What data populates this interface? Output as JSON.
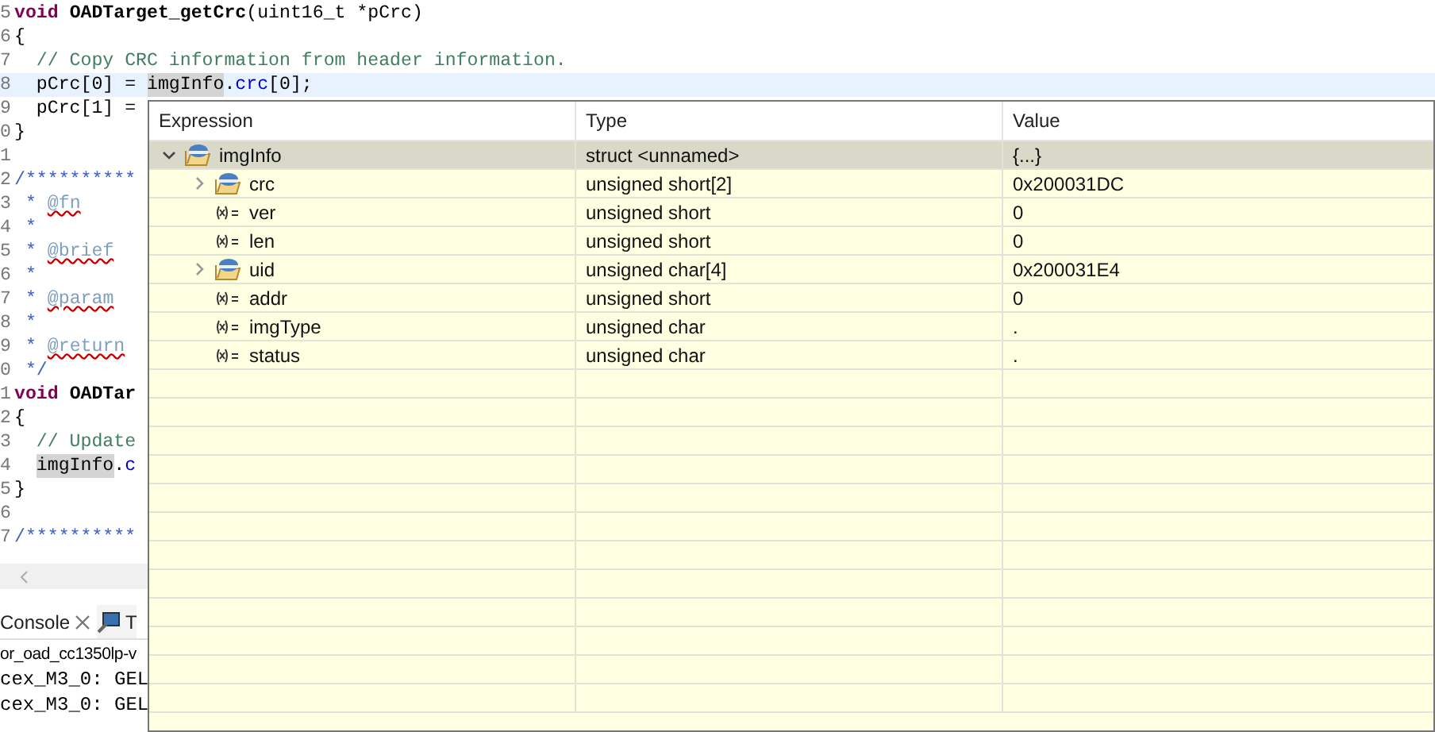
{
  "editor": {
    "lines": [
      {
        "number": "5",
        "current": false,
        "segments": [
          {
            "kind": "keyword",
            "text": "void"
          },
          {
            "kind": "bold",
            "text": " OADTarget_getCrc"
          },
          {
            "kind": "plain",
            "text": "(uint16_t *pCrc)"
          }
        ]
      },
      {
        "number": "6",
        "current": false,
        "segments": [
          {
            "kind": "plain",
            "text": "{"
          }
        ]
      },
      {
        "number": "7",
        "current": false,
        "segments": [
          {
            "kind": "comment",
            "text": "  // Copy CRC information from header information."
          }
        ]
      },
      {
        "number": "8",
        "current": true,
        "segments": [
          {
            "kind": "plain",
            "text": "  pCrc[0] = "
          },
          {
            "kind": "occurrence",
            "text": "imgInfo"
          },
          {
            "kind": "plain",
            "text": "."
          },
          {
            "kind": "field",
            "text": "crc"
          },
          {
            "kind": "plain",
            "text": "[0];"
          }
        ]
      },
      {
        "number": "9",
        "current": false,
        "segments": [
          {
            "kind": "plain",
            "text": "  pCrc[1] ="
          }
        ]
      },
      {
        "number": "0",
        "current": false,
        "segments": [
          {
            "kind": "plain",
            "text": "}"
          }
        ]
      },
      {
        "number": "1",
        "current": false
      },
      {
        "number": "2",
        "current": false,
        "segments": [
          {
            "kind": "doc",
            "text": "/**********"
          }
        ]
      },
      {
        "number": "3",
        "current": false,
        "segments": [
          {
            "kind": "doc",
            "text": " *"
          },
          {
            "kind": "tag",
            "text": " @fn"
          }
        ]
      },
      {
        "number": "4",
        "current": false,
        "segments": [
          {
            "kind": "doc",
            "text": " *"
          }
        ]
      },
      {
        "number": "5",
        "current": false,
        "segments": [
          {
            "kind": "doc",
            "text": " *"
          },
          {
            "kind": "tag",
            "text": " @brief"
          }
        ]
      },
      {
        "number": "6",
        "current": false,
        "segments": [
          {
            "kind": "doc",
            "text": " *"
          }
        ]
      },
      {
        "number": "7",
        "current": false,
        "segments": [
          {
            "kind": "doc",
            "text": " *"
          },
          {
            "kind": "tag",
            "text": " @param"
          }
        ]
      },
      {
        "number": "8",
        "current": false,
        "segments": [
          {
            "kind": "doc",
            "text": " *"
          }
        ]
      },
      {
        "number": "9",
        "current": false,
        "segments": [
          {
            "kind": "doc",
            "text": " *"
          },
          {
            "kind": "tag",
            "text": " @return"
          }
        ]
      },
      {
        "number": "0",
        "current": false,
        "segments": [
          {
            "kind": "doc",
            "text": " */"
          }
        ]
      },
      {
        "number": "1",
        "current": false,
        "segments": [
          {
            "kind": "keyword",
            "text": "void"
          },
          {
            "kind": "bold",
            "text": " OADTar"
          }
        ]
      },
      {
        "number": "2",
        "current": false,
        "segments": [
          {
            "kind": "plain",
            "text": "{"
          }
        ]
      },
      {
        "number": "3",
        "current": false,
        "segments": [
          {
            "kind": "comment",
            "text": "  // Update"
          }
        ]
      },
      {
        "number": "4",
        "current": false,
        "segments": [
          {
            "kind": "occurrence",
            "text": "  imgInfo"
          },
          {
            "kind": "plain",
            "text": "."
          },
          {
            "kind": "field",
            "text": "c"
          }
        ]
      },
      {
        "number": "5",
        "current": false,
        "segments": [
          {
            "kind": "plain",
            "text": "}"
          }
        ]
      },
      {
        "number": "6",
        "current": false
      },
      {
        "number": "7",
        "current": false,
        "segments": [
          {
            "kind": "doc",
            "text": "/**********"
          }
        ]
      }
    ]
  },
  "console": {
    "tabs": [
      {
        "label": "Console",
        "selected": true,
        "closable": true,
        "kind": "console"
      },
      {
        "label": "T",
        "selected": false,
        "closable": false,
        "kind": "terminal"
      }
    ],
    "lines": [
      "or_oad_cc1350lp-v",
      "cex_M3_0: GEL",
      "cex_M3_0: GEL"
    ]
  },
  "hover": {
    "columns": [
      "Expression",
      "Type",
      "Value"
    ],
    "rows": [
      {
        "expression": "imgInfo",
        "type": "struct <unnamed>",
        "value": "{...}",
        "kind": "struct",
        "expanded": true,
        "selected": true,
        "children": [
          {
            "expression": "crc",
            "type": "unsigned short[2]",
            "value": "0x200031DC",
            "kind": "struct",
            "expanded": false,
            "selected": false
          },
          {
            "expression": "ver",
            "type": "unsigned short",
            "value": "0",
            "kind": "variable",
            "selected": false
          },
          {
            "expression": "len",
            "type": "unsigned short",
            "value": "0",
            "kind": "variable",
            "selected": false
          },
          {
            "expression": "uid",
            "type": "unsigned char[4]",
            "value": "0x200031E4",
            "kind": "struct",
            "expanded": false,
            "selected": false
          },
          {
            "expression": "addr",
            "type": "unsigned short",
            "value": "0",
            "kind": "variable",
            "selected": false
          },
          {
            "expression": "imgType",
            "type": "unsigned char",
            "value": ".",
            "kind": "variable",
            "selected": false
          },
          {
            "expression": "status",
            "type": "unsigned char",
            "value": ".",
            "kind": "variable",
            "selected": false
          }
        ]
      }
    ]
  }
}
